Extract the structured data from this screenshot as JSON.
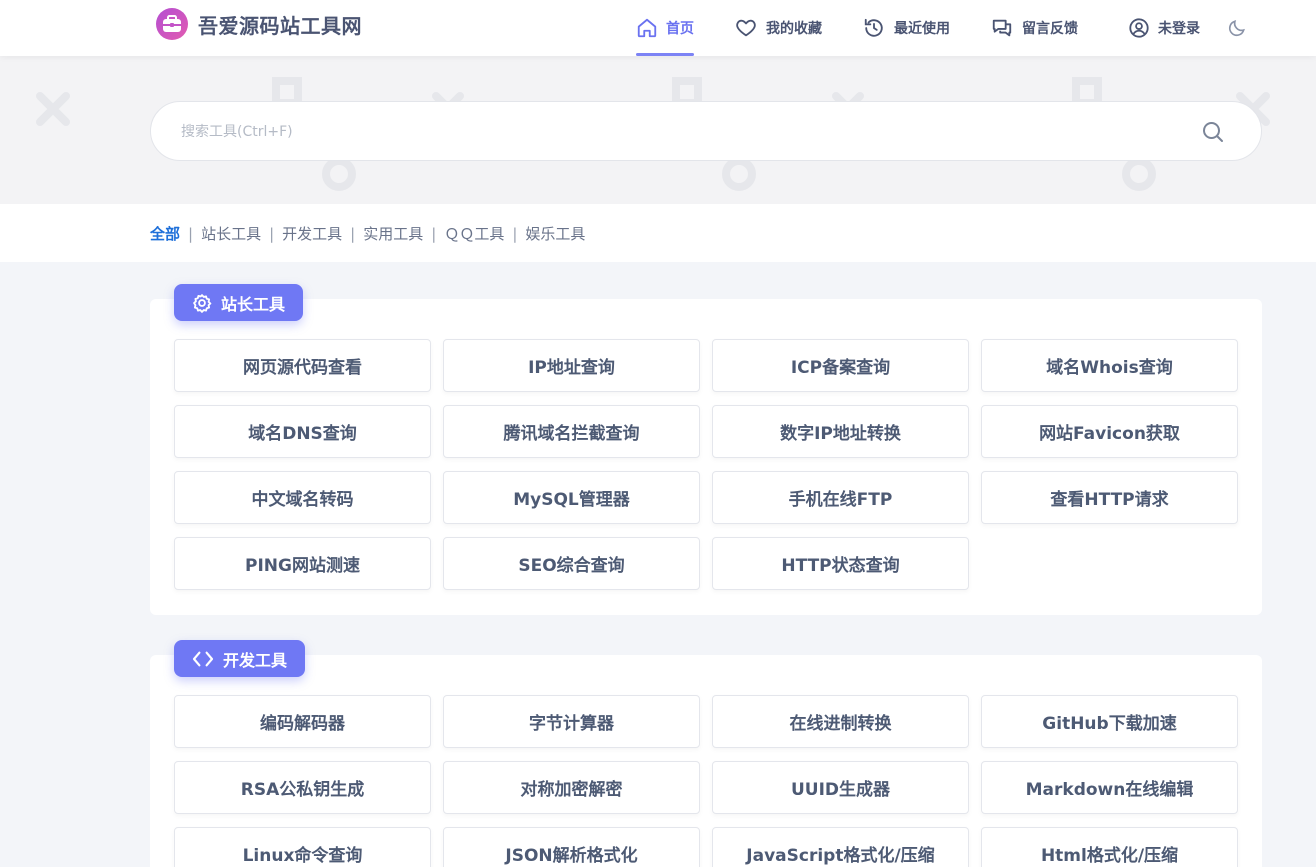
{
  "header": {
    "site_title": "吾爱源码站工具网",
    "nav": [
      {
        "label": "首页",
        "icon": "home-icon",
        "active": true
      },
      {
        "label": "我的收藏",
        "icon": "heart-icon"
      },
      {
        "label": "最近使用",
        "icon": "history-icon"
      },
      {
        "label": "留言反馈",
        "icon": "chat-icon"
      },
      {
        "label": "未登录",
        "icon": "user-icon"
      }
    ],
    "theme_toggle_icon": "moon-icon"
  },
  "search": {
    "placeholder": "搜索工具(Ctrl+F)",
    "value": ""
  },
  "categories": [
    {
      "label": "全部",
      "active": true
    },
    {
      "label": "站长工具"
    },
    {
      "label": "开发工具"
    },
    {
      "label": "实用工具"
    },
    {
      "label": "ＱＱ工具"
    },
    {
      "label": "娱乐工具"
    }
  ],
  "sections": [
    {
      "title": "站长工具",
      "icon": "gear-icon",
      "tools": [
        "网页源代码查看",
        "IP地址查询",
        "ICP备案查询",
        "域名Whois查询",
        "域名DNS查询",
        "腾讯域名拦截查询",
        "数字IP地址转换",
        "网站Favicon获取",
        "中文域名转码",
        "MySQL管理器",
        "手机在线FTP",
        "查看HTTP请求",
        "PING网站测速",
        "SEO综合查询",
        "HTTP状态查询"
      ]
    },
    {
      "title": "开发工具",
      "icon": "code-icon",
      "tools": [
        "编码解码器",
        "字节计算器",
        "在线进制转换",
        "GitHub下载加速",
        "RSA公私钥生成",
        "对称加密解密",
        "UUID生成器",
        "Markdown在线编辑",
        "Linux命令查询",
        "JSON解析格式化",
        "JavaScript格式化/压缩",
        "Html格式化/压缩"
      ]
    }
  ],
  "colors": {
    "accent": "#6f78f4",
    "active_category": "#1e6fd9",
    "nav_active": "#6a72f0",
    "text": "#4d5a74"
  }
}
